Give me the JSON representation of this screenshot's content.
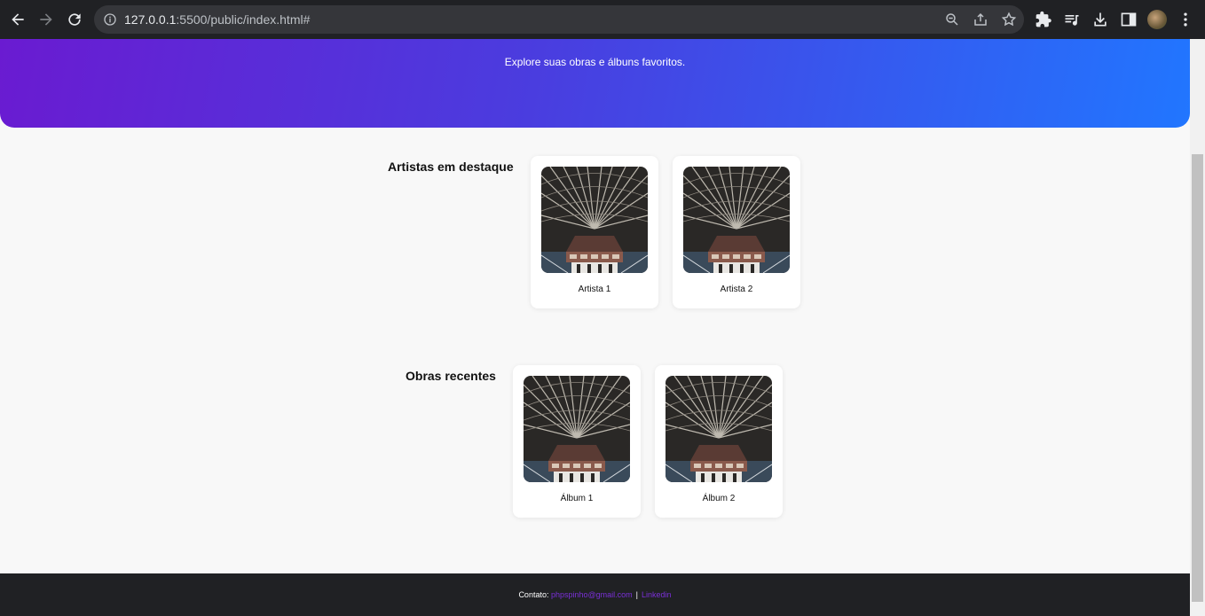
{
  "browser": {
    "url_host": "127.0.0.1",
    "url_rest": ":5500/public/index.html#"
  },
  "hero": {
    "subtitle": "Explore suas obras e álbuns favoritos."
  },
  "artists_section": {
    "title": "Artistas em destaque",
    "cards": [
      {
        "label": "Artista 1"
      },
      {
        "label": "Artista 2"
      }
    ]
  },
  "works_section": {
    "title": "Obras recentes",
    "cards": [
      {
        "label": "Álbum 1"
      },
      {
        "label": "Álbum 2"
      }
    ]
  },
  "footer": {
    "contact_label": "Contato:",
    "email": "phpspinho@gmail.com",
    "separator": "|",
    "linkedin": "Linkedin"
  }
}
